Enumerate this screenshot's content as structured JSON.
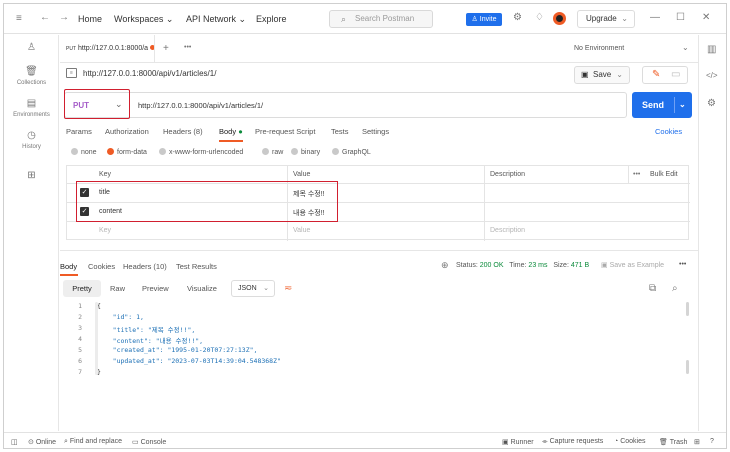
{
  "topbar": {
    "home": "Home",
    "workspaces": "Workspaces",
    "api_network": "API Network",
    "explore": "Explore",
    "search_placeholder": "Search Postman",
    "invite": "Invite",
    "upgrade": "Upgrade"
  },
  "sidebar": {
    "items": [
      {
        "label": "",
        "icon": "person-icon"
      },
      {
        "label": "Collections",
        "icon": "trash-can-icon"
      },
      {
        "label": "Environments",
        "icon": "environment-icon"
      },
      {
        "label": "History",
        "icon": "history-icon"
      },
      {
        "label": "",
        "icon": "grid-add-icon"
      }
    ]
  },
  "tab": {
    "method": "PUT",
    "url": "http://127.0.0.1:8000/a",
    "environment": "No Environment"
  },
  "request": {
    "breadcrumb": "http://127.0.0.1:8000/api/v1/articles/1/",
    "save": "Save",
    "method": "PUT",
    "url": "http://127.0.0.1:8000/api/v1/articles/1/",
    "send": "Send",
    "tabs": [
      "Params",
      "Authorization",
      "Headers (8)",
      "Body",
      "Pre-request Script",
      "Tests",
      "Settings"
    ],
    "cookies": "Cookies",
    "body_types": [
      "none",
      "form-data",
      "x-www-form-urlencoded",
      "raw",
      "binary",
      "GraphQL"
    ],
    "table": {
      "headers": [
        "Key",
        "Value",
        "Description"
      ],
      "bulk_edit": "Bulk Edit",
      "rows": [
        {
          "key": "title",
          "value": "제목 수정!!"
        },
        {
          "key": "content",
          "value": "내용 수정!!"
        }
      ],
      "placeholder": {
        "key": "Key",
        "value": "Value",
        "description": "Description"
      }
    }
  },
  "response": {
    "tabs": [
      "Body",
      "Cookies",
      "Headers (10)",
      "Test Results"
    ],
    "status_label": "Status:",
    "status_value": "200 OK",
    "time_label": "Time:",
    "time_value": "23 ms",
    "size_label": "Size:",
    "size_value": "471 B",
    "save_example": "Save as Example",
    "formats": [
      "Pretty",
      "Raw",
      "Preview",
      "Visualize"
    ],
    "json_label": "JSON",
    "lines": [
      {
        "n": "1",
        "t": "{"
      },
      {
        "n": "2",
        "t": "    \"id\": 1,"
      },
      {
        "n": "3",
        "t": "    \"title\": \"제목 수정!!\","
      },
      {
        "n": "4",
        "t": "    \"content\": \"내용 수정!!\","
      },
      {
        "n": "5",
        "t": "    \"created_at\": \"1995-01-20T07:27:13Z\","
      },
      {
        "n": "6",
        "t": "    \"updated_at\": \"2023-07-03T14:39:04.548368Z\""
      },
      {
        "n": "7",
        "t": "}"
      }
    ]
  },
  "bottombar": {
    "online": "Online",
    "find_replace": "Find and replace",
    "console": "Console",
    "runner": "Runner",
    "capture": "Capture requests",
    "cookies": "Cookies",
    "trash": "Trash"
  },
  "colors": {
    "accent": "#ef5b25",
    "primary": "#1f6feb",
    "highlight": "#d11f2f",
    "method_put": "#a65ec9",
    "status_ok": "#0a8a3a"
  }
}
